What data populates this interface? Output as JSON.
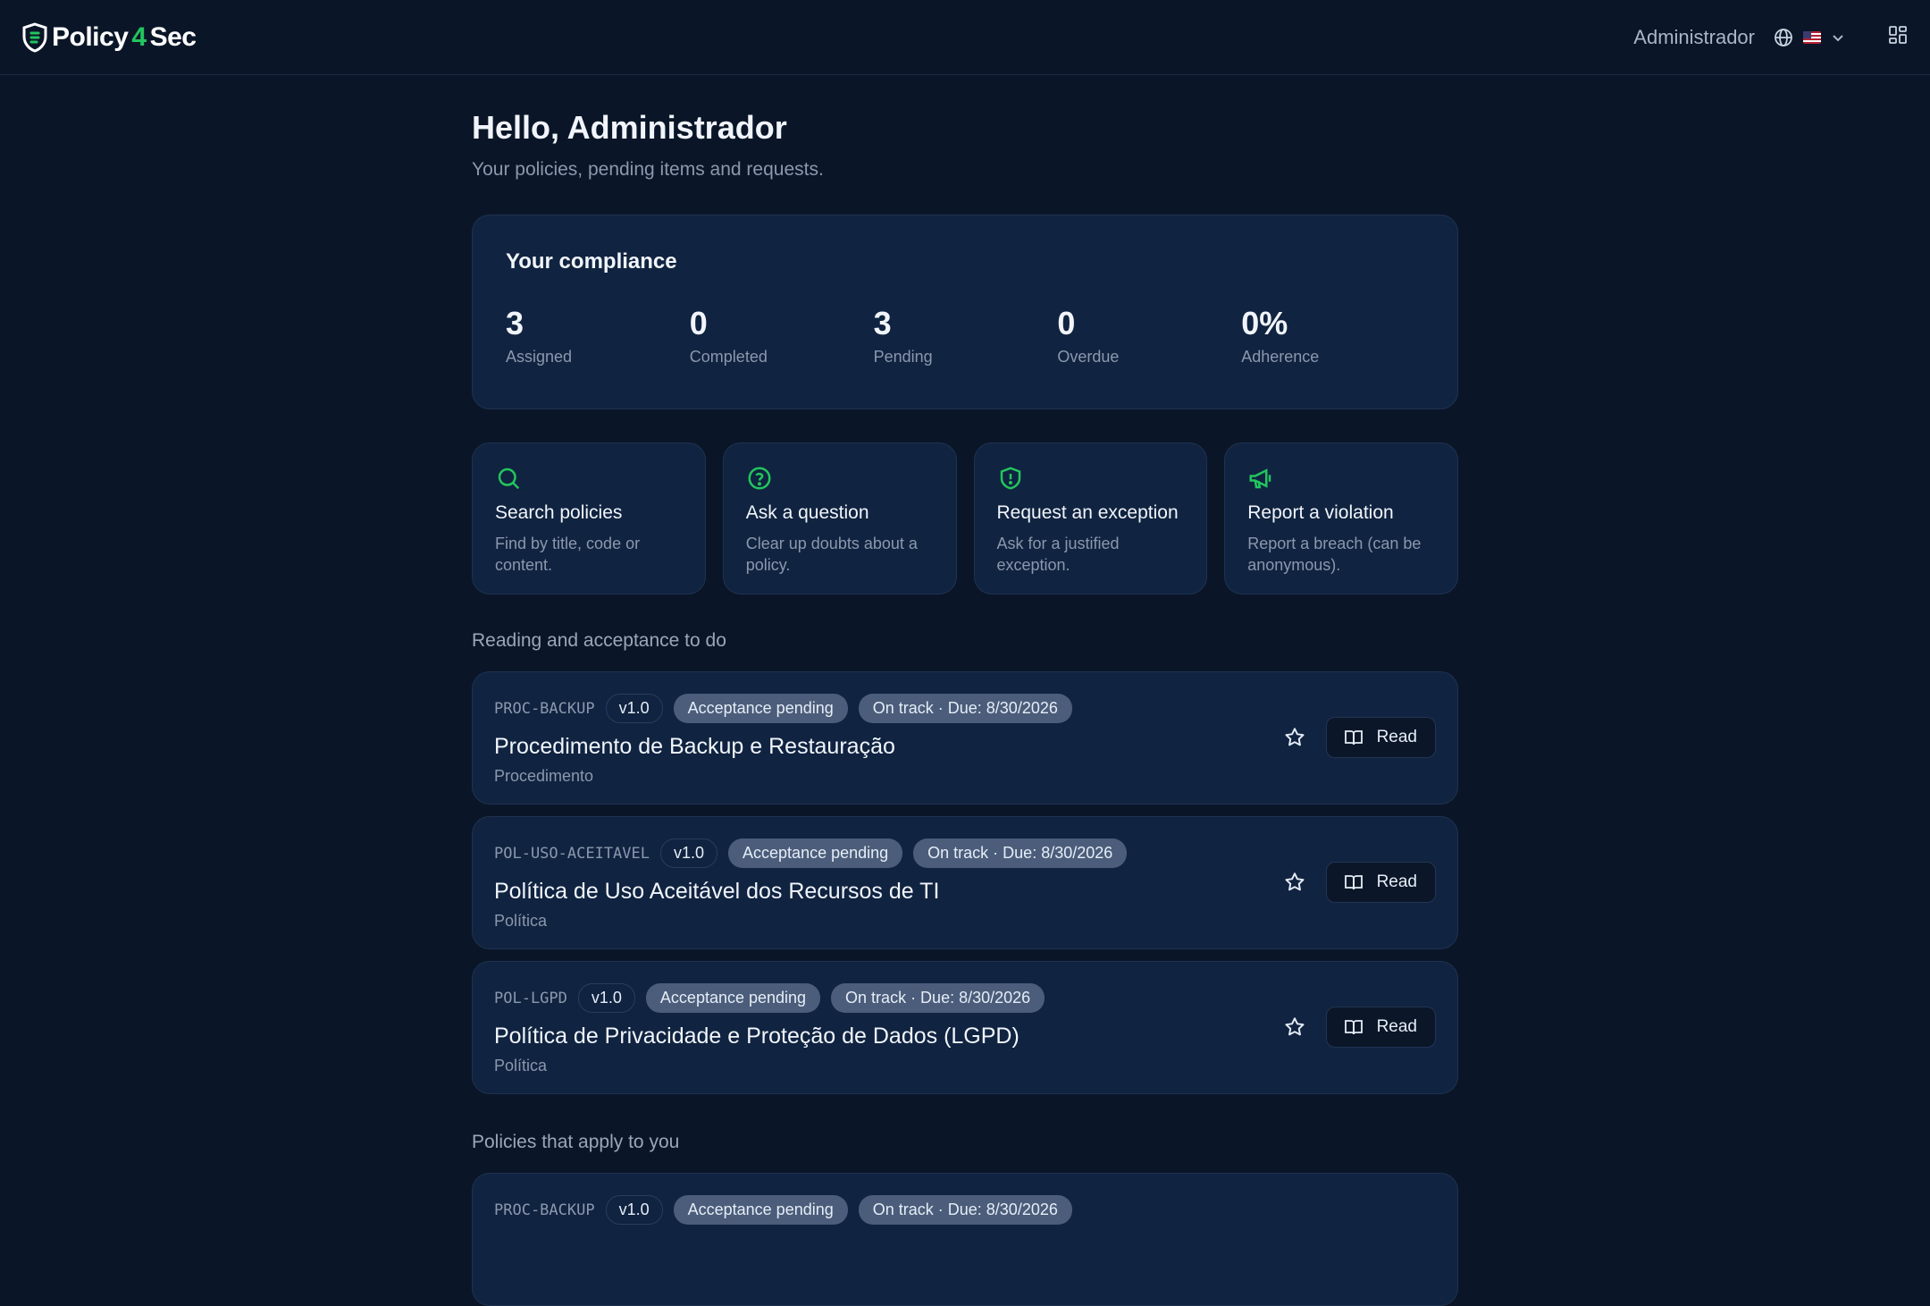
{
  "app": {
    "logo_part1": "Policy",
    "logo_bolt": "4",
    "logo_part2": "Sec"
  },
  "header": {
    "user_name": "Administrador"
  },
  "greeting": {
    "title": "Hello, Administrador",
    "subtitle": "Your policies, pending items and requests."
  },
  "compliance": {
    "title": "Your compliance",
    "stats": [
      {
        "value": "3",
        "label": "Assigned"
      },
      {
        "value": "0",
        "label": "Completed"
      },
      {
        "value": "3",
        "label": "Pending"
      },
      {
        "value": "0",
        "label": "Overdue"
      },
      {
        "value": "0%",
        "label": "Adherence"
      }
    ]
  },
  "actions": [
    {
      "icon": "search-icon",
      "title": "Search policies",
      "desc": "Find by title, code or content."
    },
    {
      "icon": "help-circle-icon",
      "title": "Ask a question",
      "desc": "Clear up doubts about a policy."
    },
    {
      "icon": "shield-alert-icon",
      "title": "Request an exception",
      "desc": "Ask for a justified exception."
    },
    {
      "icon": "megaphone-icon",
      "title": "Report a violation",
      "desc": "Report a breach (can be anonymous)."
    }
  ],
  "todo": {
    "title": "Reading and acceptance to do",
    "items": [
      {
        "code": "PROC-BACKUP",
        "version": "v1.0",
        "status": "Acceptance pending",
        "due": "On track · Due: 8/30/2026",
        "title": "Procedimento de Backup e Restauração",
        "type": "Procedimento",
        "action": "Read"
      },
      {
        "code": "POL-USO-ACEITAVEL",
        "version": "v1.0",
        "status": "Acceptance pending",
        "due": "On track · Due: 8/30/2026",
        "title": "Política de Uso Aceitável dos Recursos de TI",
        "type": "Política",
        "action": "Read"
      },
      {
        "code": "POL-LGPD",
        "version": "v1.0",
        "status": "Acceptance pending",
        "due": "On track · Due: 8/30/2026",
        "title": "Política de Privacidade e Proteção de Dados (LGPD)",
        "type": "Política",
        "action": "Read"
      }
    ]
  },
  "applies": {
    "title": "Policies that apply to you",
    "items": [
      {
        "code": "PROC-BACKUP",
        "version": "v1.0",
        "status": "Acceptance pending",
        "due": "On track · Due: 8/30/2026"
      }
    ]
  },
  "colors": {
    "background": "#0a1628",
    "card": "#102340",
    "accent": "#22c55e",
    "pill": "#4b5d7a"
  }
}
